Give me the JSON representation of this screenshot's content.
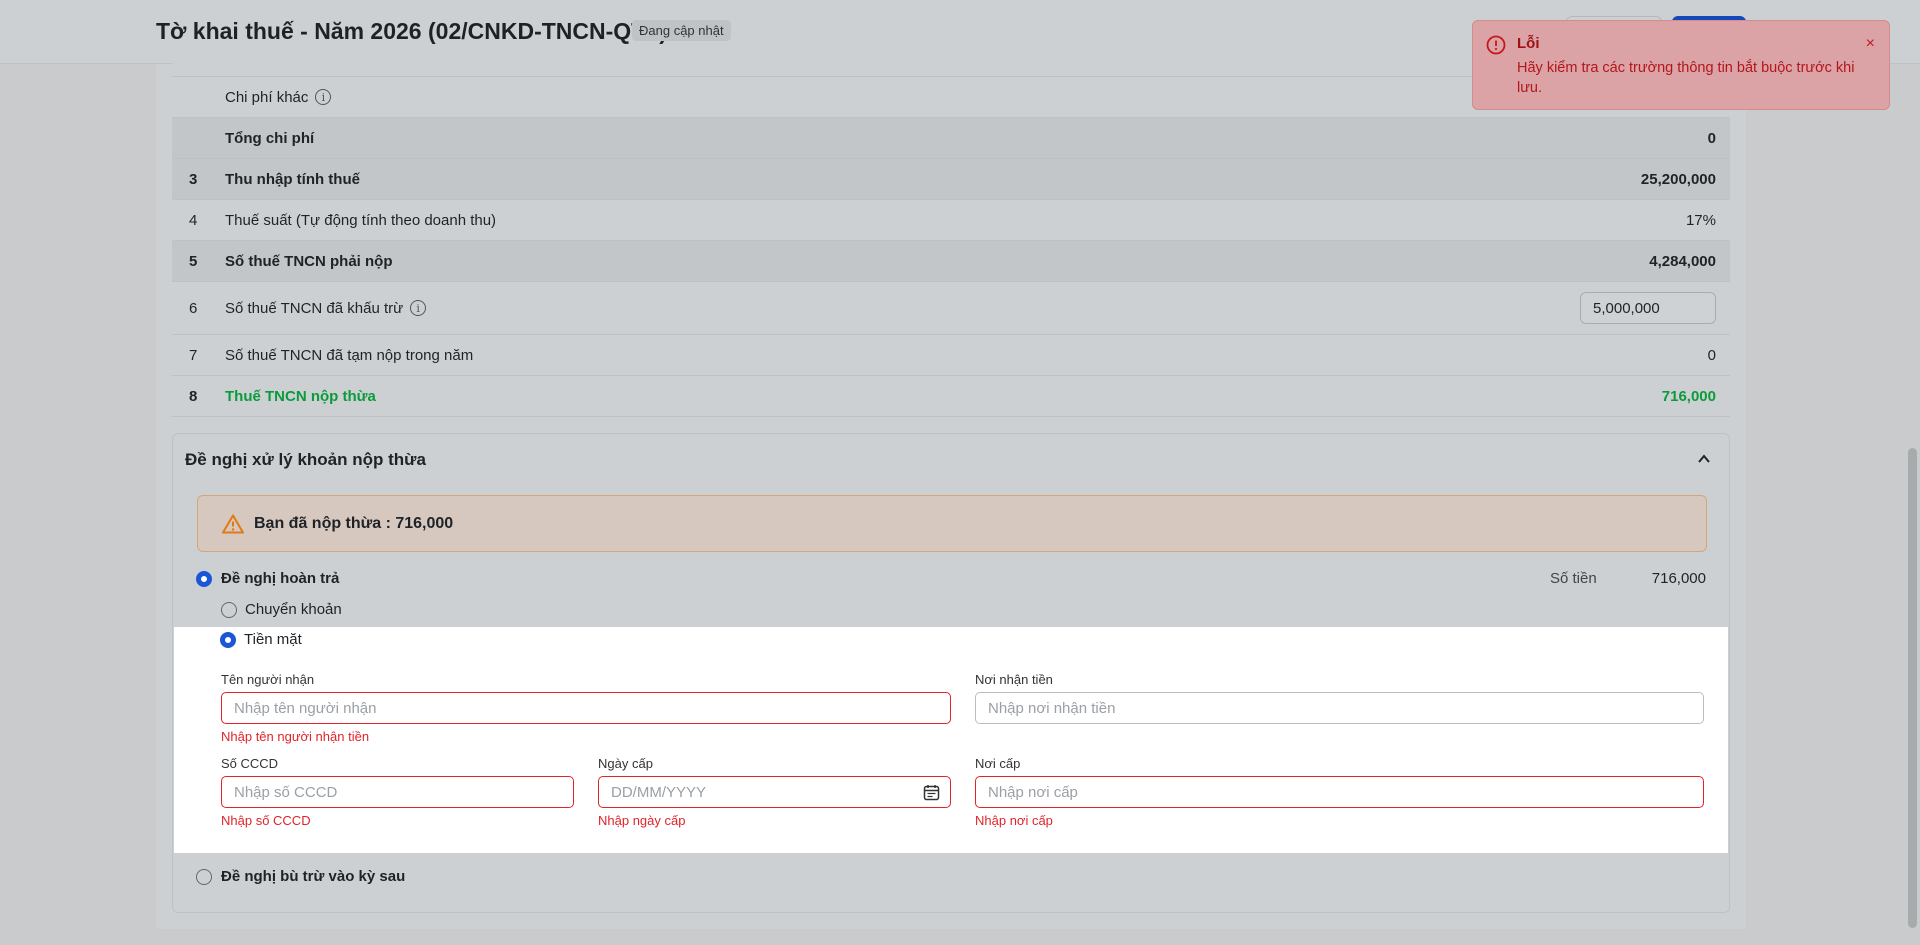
{
  "header": {
    "title": "Tờ khai thuế - Năm 2026 (02/CNKD-TNCN-QTT)",
    "status_badge": "Đang cập nhật"
  },
  "table": {
    "rows": [
      {
        "num": "",
        "label": "Chi phí khác",
        "value": "",
        "info": true
      },
      {
        "num": "",
        "label": "Tổng chi phí",
        "value": "0"
      },
      {
        "num": "3",
        "label": "Thu nhập tính thuế",
        "value": "25,200,000"
      },
      {
        "num": "4",
        "label": "Thuế suất (Tự động tính theo doanh thu)",
        "value": "17%"
      },
      {
        "num": "5",
        "label": "Số thuế TNCN phải nộp",
        "value": "4,284,000"
      },
      {
        "num": "6",
        "label": "Số thuế TNCN đã khấu trừ",
        "value": "5,000,000",
        "info": true
      },
      {
        "num": "7",
        "label": "Số thuế TNCN đã tạm nộp trong năm",
        "value": "0"
      },
      {
        "num": "8",
        "label": "Thuế TNCN nộp thừa",
        "value": "716,000"
      }
    ]
  },
  "overpay_section": {
    "title": "Đề nghị xử lý khoản nộp thừa",
    "alert_text": "Bạn đã nộp thừa : 716,000",
    "refund_option": "Đề nghị hoàn trả",
    "amount_label": "Số tiền",
    "amount_value": "716,000",
    "method_transfer": "Chuyển khoản",
    "method_cash": "Tiền mặt",
    "offset_option": "Đề nghị bù trừ vào kỳ sau"
  },
  "form": {
    "recipient_label": "Tên người nhận",
    "recipient_placeholder": "Nhập tên người nhận",
    "recipient_error": "Nhập tên người nhận tiền",
    "receive_place_label": "Nơi nhận tiền",
    "receive_place_placeholder": "Nhập nơi nhận tiền",
    "id_label": "Số CCCD",
    "id_placeholder": "Nhập số CCCD",
    "id_error": "Nhập số CCCD",
    "issue_date_label": "Ngày cấp",
    "issue_date_placeholder": "DD/MM/YYYY",
    "issue_date_error": "Nhập ngày cấp",
    "issue_place_label": "Nơi cấp",
    "issue_place_placeholder": "Nhập nơi cấp",
    "issue_place_error": "Nhập nơi cấp"
  },
  "toast": {
    "title": "Lỗi",
    "message": "Hãy kiểm tra các trường thông tin bắt buộc trước khi lưu.",
    "close": "×"
  },
  "colors": {
    "error": "#e0242a",
    "accent": "#1a56d6",
    "success": "#0a9b3b",
    "warning": "#e07a12"
  }
}
